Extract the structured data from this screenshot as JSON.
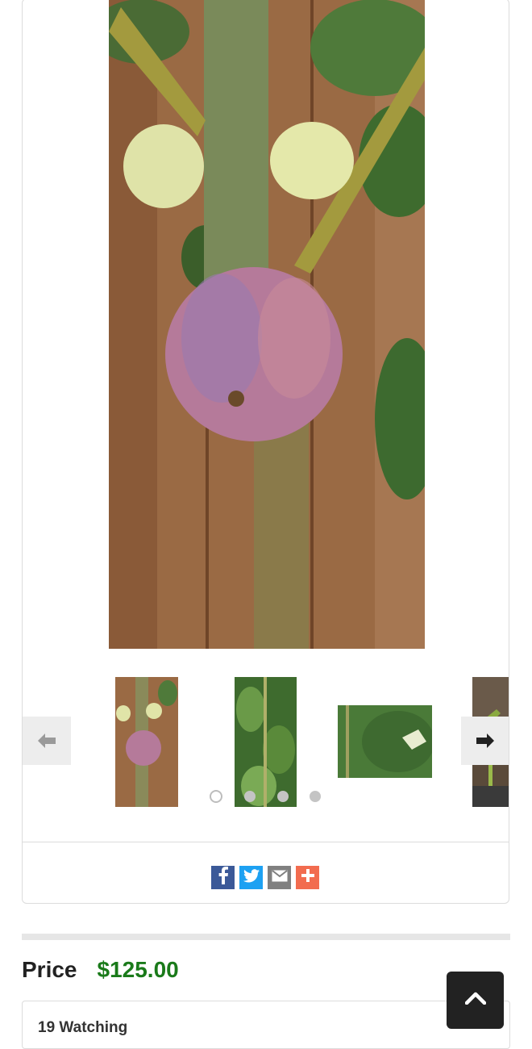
{
  "gallery": {
    "main_image": "fig-tree-with-ripe-fig",
    "thumbnails": [
      "fig-tree-ripe-fig-thumb",
      "fig-branches-thumb",
      "fig-leaf-thumb",
      "potted-fig-thumb"
    ],
    "dots_total": 4,
    "dot_active": 1,
    "prev_icon": "arrow-left-icon",
    "next_icon": "arrow-right-icon"
  },
  "share": {
    "icons": [
      "facebook-icon",
      "twitter-icon",
      "email-icon",
      "plus-icon"
    ],
    "colors": {
      "facebook": "#3b5998",
      "twitter": "#1da1f2",
      "email": "#808080",
      "plus": "#f26c4f"
    }
  },
  "price": {
    "label": "Price",
    "value": "$125.00",
    "value_color": "#1a7a1a"
  },
  "watching": {
    "text": "19 Watching"
  },
  "scroll_top": {
    "icon": "chevron-up-icon"
  }
}
